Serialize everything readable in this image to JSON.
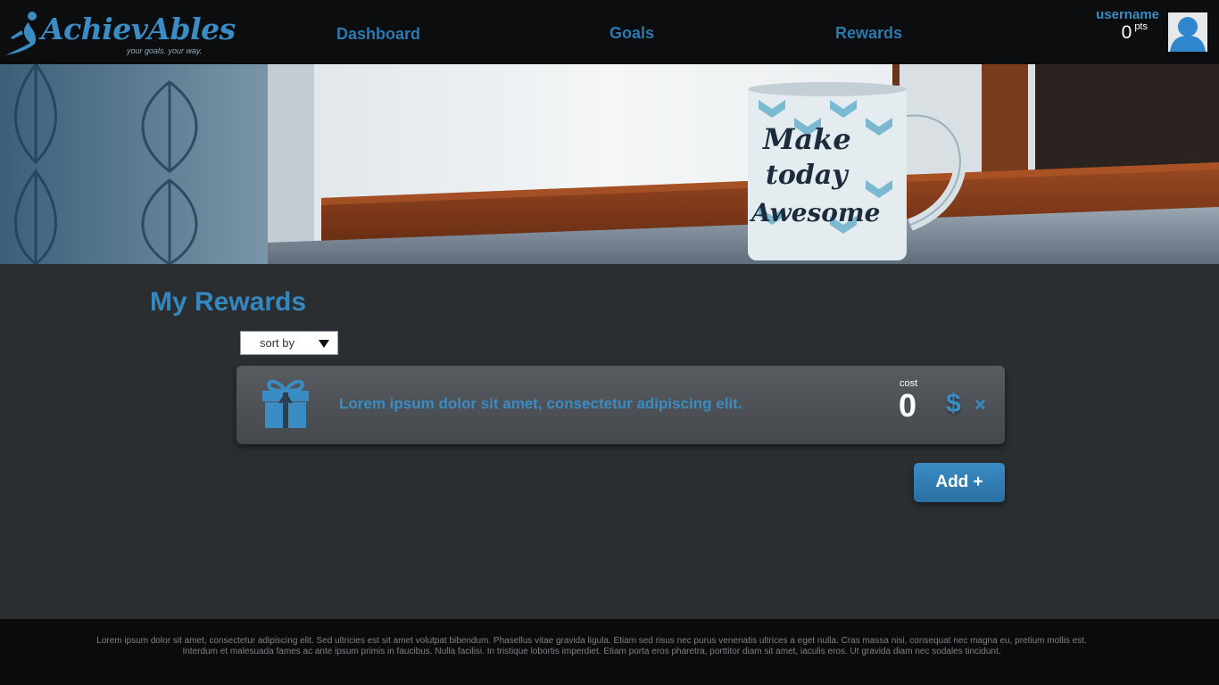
{
  "header": {
    "logo": {
      "name": "AchievAbles",
      "tagline": "your goals. your way."
    },
    "nav": [
      {
        "label": "Dashboard"
      },
      {
        "label": "Goals"
      },
      {
        "label": "Rewards"
      }
    ],
    "user": {
      "name": "username",
      "points": "0",
      "points_unit": "pts"
    }
  },
  "banner": {
    "mug_text": [
      "Make",
      "today",
      "Awesome"
    ]
  },
  "main": {
    "title": "My Rewards",
    "sort_label": "sort by",
    "rewards": [
      {
        "description": "Lorem ipsum dolor sit amet, consectetur adipiscing elit.",
        "cost_label": "cost",
        "cost": "0",
        "redeem_icon": "$",
        "delete_icon": "×"
      }
    ],
    "add_label": "Add +"
  },
  "footer": {
    "text": "Lorem ipsum dolor sit amet, consectetur adipiscing elit. Sed ultricies est sit amet volutpat bibendum. Phasellus vitae gravida ligula. Etiam sed risus nec purus venenatis ultrices a eget nulla. Cras massa nisi, consequat nec magna eu, pretium mollis est. Interdum et malesuada fames ac ante ipsum primis in faucibus. Nulla facilisi. In tristique lobortis imperdiet. Etiam porta eros pharetra, porttitor diam sit amet, iaculis eros. Ut gravida diam nec sodales tincidunt."
  },
  "colors": {
    "accent": "#3a8cc4",
    "nav_link": "#2c78b0",
    "page_background": "#2a2e31",
    "header_background": "#0c0d0e",
    "card_background": "#4f5358"
  }
}
